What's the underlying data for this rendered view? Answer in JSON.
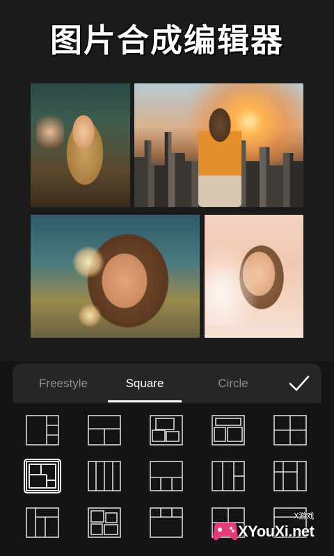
{
  "header": {
    "title": "图片合成编辑器"
  },
  "collage": {
    "photos": [
      {
        "description_name": "photo-1"
      },
      {
        "description_name": "photo-2"
      },
      {
        "description_name": "photo-3"
      },
      {
        "description_name": "photo-4"
      }
    ]
  },
  "tabs": {
    "items": [
      {
        "label": "Freestyle",
        "active": false
      },
      {
        "label": "Square",
        "active": true
      },
      {
        "label": "Circle",
        "active": false
      }
    ],
    "confirm_icon": "checkmark-icon"
  },
  "layouts": {
    "selected_index": 5,
    "rows": 3,
    "columns": 5,
    "line_color": "#d9d9d9",
    "selected_color": "#ffffff"
  },
  "watermark": {
    "top_text": "X游戏",
    "site": "XYouXi.net",
    "logo_color": "#e6397a"
  },
  "colors": {
    "background": "#1b1b1b",
    "panel": "#141414",
    "tab_bar": "#262626",
    "active_tab": "#ffffff",
    "inactive_tab": "#8e8e8e"
  }
}
